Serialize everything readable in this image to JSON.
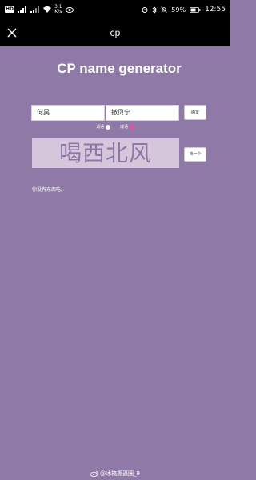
{
  "status_bar": {
    "left_badge": "HD",
    "network_speed": "3.1\nK/s",
    "battery": "59%",
    "time": "12:55"
  },
  "titlebar": {
    "title": "cp",
    "close_icon": "close-icon"
  },
  "generator": {
    "heading": "CP name generator",
    "name_field_1": "何昊",
    "name_field_2": "撤贝宁",
    "confirm_label": "确定",
    "toggle_a_label": "词语",
    "toggle_b_label": "成语",
    "result": "喝西北风",
    "another_label": "换一个",
    "hint": "你没有东西吃。"
  },
  "watermark": {
    "text": "@冰箱撕逼圈_9"
  },
  "colors": {
    "background": "#8f7aa7",
    "result_bg": "#d6c6dc",
    "result_text": "#8d77a4",
    "toggle_pink": "#e24fa7"
  }
}
